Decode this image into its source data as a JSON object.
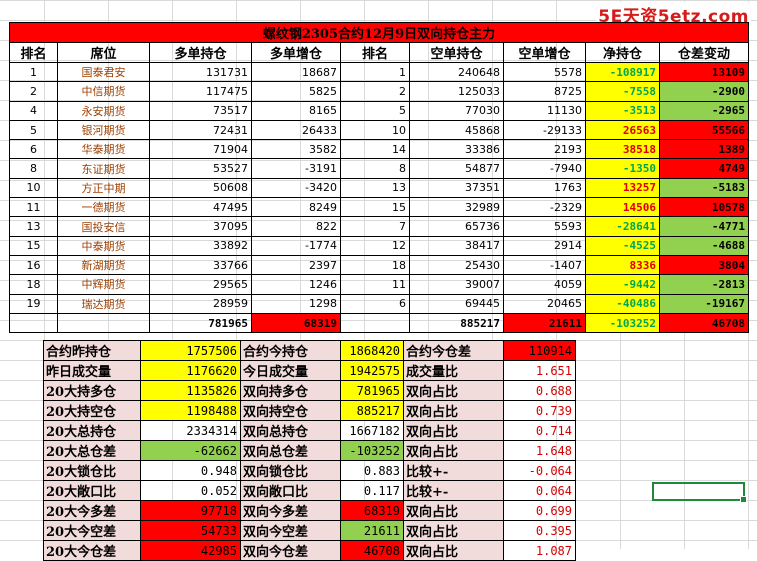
{
  "watermark": "5E天资5etz.com",
  "title": "螺纹钢2305合约12月9日双向持仓主力",
  "headers": [
    "排名",
    "席位",
    "多单持仓",
    "多单增仓",
    "排名",
    "空单持仓",
    "空单增仓",
    "净持仓",
    "仓差变动"
  ],
  "rows": [
    {
      "rank": "1",
      "name": "国泰君安",
      "long": "131731",
      "long_chg": "18687",
      "srank": "1",
      "short": "240648",
      "short_chg": "5578",
      "net": "-108917",
      "diff": "13109",
      "net_color": "yg",
      "diff_color": "red"
    },
    {
      "rank": "2",
      "name": "中信期货",
      "long": "117475",
      "long_chg": "5825",
      "srank": "2",
      "short": "125033",
      "short_chg": "8725",
      "net": "-7558",
      "diff": "-2900",
      "net_color": "yg",
      "diff_color": "grn"
    },
    {
      "rank": "4",
      "name": "永安期货",
      "long": "73517",
      "long_chg": "8165",
      "srank": "5",
      "short": "77030",
      "short_chg": "11130",
      "net": "-3513",
      "diff": "-2965",
      "net_color": "yg",
      "diff_color": "grn"
    },
    {
      "rank": "5",
      "name": "银河期货",
      "long": "72431",
      "long_chg": "26433",
      "srank": "10",
      "short": "45868",
      "short_chg": "-29133",
      "net": "26563",
      "diff": "55566",
      "net_color": "yr",
      "diff_color": "red"
    },
    {
      "rank": "6",
      "name": "华泰期货",
      "long": "71904",
      "long_chg": "3582",
      "srank": "14",
      "short": "33386",
      "short_chg": "2193",
      "net": "38518",
      "diff": "1389",
      "net_color": "yr",
      "diff_color": "red"
    },
    {
      "rank": "8",
      "name": "东证期货",
      "long": "53527",
      "long_chg": "-3191",
      "srank": "8",
      "short": "54877",
      "short_chg": "-7940",
      "net": "-1350",
      "diff": "4749",
      "net_color": "yg",
      "diff_color": "red"
    },
    {
      "rank": "10",
      "name": "方正中期",
      "long": "50608",
      "long_chg": "-3420",
      "srank": "13",
      "short": "37351",
      "short_chg": "1763",
      "net": "13257",
      "diff": "-5183",
      "net_color": "yr",
      "diff_color": "grn"
    },
    {
      "rank": "11",
      "name": "一德期货",
      "long": "47495",
      "long_chg": "8249",
      "srank": "15",
      "short": "32989",
      "short_chg": "-2329",
      "net": "14506",
      "diff": "10578",
      "net_color": "yr",
      "diff_color": "red"
    },
    {
      "rank": "13",
      "name": "国投安信",
      "long": "37095",
      "long_chg": "822",
      "srank": "7",
      "short": "65736",
      "short_chg": "5593",
      "net": "-28641",
      "diff": "-4771",
      "net_color": "yg",
      "diff_color": "grn"
    },
    {
      "rank": "15",
      "name": "中泰期货",
      "long": "33892",
      "long_chg": "-1774",
      "srank": "12",
      "short": "38417",
      "short_chg": "2914",
      "net": "-4525",
      "diff": "-4688",
      "net_color": "yg",
      "diff_color": "grn"
    },
    {
      "rank": "16",
      "name": "新湖期货",
      "long": "33766",
      "long_chg": "2397",
      "srank": "18",
      "short": "25430",
      "short_chg": "-1407",
      "net": "8336",
      "diff": "3804",
      "net_color": "yr",
      "diff_color": "red"
    },
    {
      "rank": "18",
      "name": "中辉期货",
      "long": "29565",
      "long_chg": "1246",
      "srank": "11",
      "short": "39007",
      "short_chg": "4059",
      "net": "-9442",
      "diff": "-2813",
      "net_color": "yg",
      "diff_color": "grn"
    },
    {
      "rank": "19",
      "name": "瑞达期货",
      "long": "28959",
      "long_chg": "1298",
      "srank": "6",
      "short": "69445",
      "short_chg": "20465",
      "net": "-40486",
      "diff": "-19167",
      "net_color": "yg",
      "diff_color": "grn"
    }
  ],
  "totals": {
    "long": "781965",
    "long_chg": "68319",
    "short": "885217",
    "short_chg": "21611",
    "net": "-103252",
    "diff": "46708"
  },
  "summary": [
    {
      "l1": "合约昨持仓",
      "v1": "1757506",
      "c1": "ry",
      "l2": "合约今持仓",
      "v2": "1868420",
      "c2": "ry",
      "l3": "合约今仓差",
      "v3": "110914",
      "c3": "rr"
    },
    {
      "l1": "昨日成交量",
      "v1": "1176620",
      "c1": "ry",
      "l2": "今日成交量",
      "v2": "1942575",
      "c2": "ry",
      "l3": "成交量比",
      "v3": "1.651",
      "c3": "rt"
    },
    {
      "l1": "20大持多仓",
      "v1": "1135826",
      "c1": "ry",
      "l2": "双向持多仓",
      "v2": "781965",
      "c2": "ry",
      "l3": "双向占比",
      "v3": "0.688",
      "c3": "rt"
    },
    {
      "l1": "20大持空仓",
      "v1": "1198488",
      "c1": "ry",
      "l2": "双向持空仓",
      "v2": "885217",
      "c2": "ry",
      "l3": "双向占比",
      "v3": "0.739",
      "c3": "rt"
    },
    {
      "l1": "20大总持仓",
      "v1": "2334314",
      "c1": "",
      "l2": "双向总持仓",
      "v2": "1667182",
      "c2": "",
      "l3": "双向占比",
      "v3": "0.714",
      "c3": "rt"
    },
    {
      "l1": "20大总仓差",
      "v1": "-62662",
      "c1": "rg",
      "l2": "双向总仓差",
      "v2": "-103252",
      "c2": "rg",
      "l3": "双向占比",
      "v3": "1.648",
      "c3": "rt"
    },
    {
      "l1": "20大锁仓比",
      "v1": "0.948",
      "c1": "",
      "l2": "双向锁仓比",
      "v2": "0.883",
      "c2": "",
      "l3": "比较+-",
      "v3": "-0.064",
      "c3": "rt"
    },
    {
      "l1": "20大敞口比",
      "v1": "0.052",
      "c1": "",
      "l2": "双向敞口比",
      "v2": "0.117",
      "c2": "",
      "l3": "比较+-",
      "v3": "0.064",
      "c3": "rt"
    },
    {
      "l1": "20大今多差",
      "v1": "97718",
      "c1": "rr",
      "l2": "双向今多差",
      "v2": "68319",
      "c2": "rr",
      "l3": "双向占比",
      "v3": "0.699",
      "c3": "rt"
    },
    {
      "l1": "20大今空差",
      "v1": "54733",
      "c1": "rr",
      "l2": "双向今空差",
      "v2": "21611",
      "c2": "rg",
      "l3": "双向占比",
      "v3": "0.395",
      "c3": "rt"
    },
    {
      "l1": "20大今仓差",
      "v1": "42985",
      "c1": "rr",
      "l2": "双向今仓差",
      "v2": "46708",
      "c2": "rr",
      "l3": "双向占比",
      "v3": "1.087",
      "c3": "rt"
    }
  ]
}
